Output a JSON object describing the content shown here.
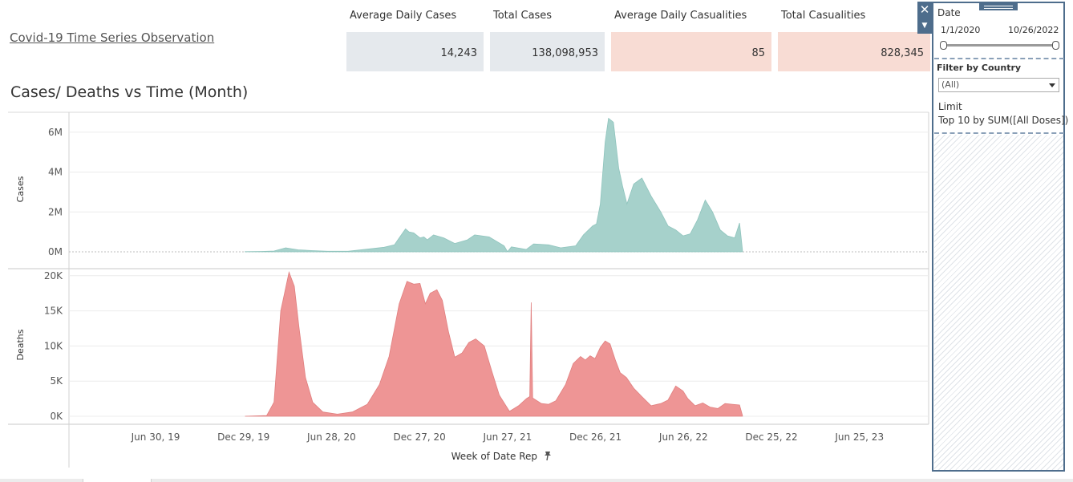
{
  "header": {
    "title": "Covid-19 Time Series Observation"
  },
  "kpis": [
    {
      "label": "Average Daily Cases",
      "value": "14,243"
    },
    {
      "label": "Total Cases",
      "value": "138,098,953"
    },
    {
      "label": "Average Daily Casualities",
      "value": "85"
    },
    {
      "label": "Total Casualities",
      "value": "828,345"
    }
  ],
  "colors": {
    "cases": "#a6d1cb",
    "cases_line": "#8fc4bd",
    "deaths": "#ee9595",
    "deaths_line": "#e07f7f",
    "kpi_blue": "#e5e9ed",
    "kpi_pink": "#f8dcd4",
    "panel_border": "#4e6d8c"
  },
  "filters": {
    "date_label": "Date",
    "date_start": "1/1/2020",
    "date_end": "10/26/2022",
    "country_label": "Filter by Country",
    "country_value": "(All)",
    "limit_label": "Limit",
    "limit_value": "Top 10 by SUM([All Doses])"
  },
  "icons": {
    "close": "close-icon",
    "menu": "menu-caret-icon",
    "pin": "pin-icon",
    "dropdown": "chevron-down-icon"
  },
  "chart_data": {
    "type": "area",
    "title": "Cases/ Deaths vs Time (Month)",
    "xlabel": "Week of Date Rep",
    "x_ticks": [
      "Jun 30, 19",
      "Dec 29, 19",
      "Jun 28, 20",
      "Dec 27, 20",
      "Jun 27, 21",
      "Dec 26, 21",
      "Jun 26, 22",
      "Dec 25, 22",
      "Jun 25, 23"
    ],
    "grid": true,
    "panels": [
      {
        "name": "Cases",
        "ylabel": "Cases",
        "ylim": [
          0,
          7000000
        ],
        "y_ticks": [
          0,
          2000000,
          4000000,
          6000000
        ],
        "y_tick_labels": [
          "0M",
          "2M",
          "4M",
          "6M"
        ],
        "series": [
          {
            "x": [
              "2020-01-01",
              "2020-02-05",
              "2020-03-01",
              "2020-03-25",
              "2020-04-20",
              "2020-05-20",
              "2020-06-20",
              "2020-08-01",
              "2020-09-15",
              "2020-10-15",
              "2020-11-05",
              "2020-11-15",
              "2020-11-28",
              "2020-12-05",
              "2020-12-15",
              "2020-12-28",
              "2021-01-05",
              "2021-01-12",
              "2021-01-25",
              "2021-02-15",
              "2021-03-10",
              "2021-04-05",
              "2021-04-20",
              "2021-05-20",
              "2021-06-20",
              "2021-06-27",
              "2021-07-05",
              "2021-08-05",
              "2021-08-20",
              "2021-09-20",
              "2021-10-15",
              "2021-11-15",
              "2021-12-01",
              "2021-12-20",
              "2021-12-28",
              "2022-01-05",
              "2022-01-15",
              "2022-01-22",
              "2022-02-01",
              "2022-02-12",
              "2022-02-20",
              "2022-03-01",
              "2022-03-15",
              "2022-04-01",
              "2022-04-20",
              "2022-05-10",
              "2022-05-25",
              "2022-06-10",
              "2022-06-25",
              "2022-07-10",
              "2022-07-25",
              "2022-08-10",
              "2022-08-25",
              "2022-09-10",
              "2022-09-25",
              "2022-10-10",
              "2022-10-20",
              "2022-10-26"
            ],
            "values": [
              10000,
              20000,
              40000,
              200000,
              100000,
              60000,
              30000,
              30000,
              150000,
              230000,
              350000,
              700000,
              1150000,
              1000000,
              950000,
              700000,
              750000,
              600000,
              850000,
              700000,
              420000,
              600000,
              850000,
              750000,
              300000,
              10000,
              250000,
              120000,
              400000,
              350000,
              200000,
              300000,
              850000,
              1300000,
              1400000,
              2400000,
              5500000,
              6700000,
              6500000,
              4200000,
              3300000,
              2400000,
              3400000,
              3700000,
              2800000,
              2000000,
              1300000,
              1100000,
              800000,
              900000,
              1600000,
              2600000,
              2000000,
              1100000,
              800000,
              700000,
              1450000,
              100000
            ]
          }
        ]
      },
      {
        "name": "Deaths",
        "ylabel": "Deaths",
        "ylim": [
          0,
          21000
        ],
        "y_ticks": [
          0,
          5000,
          10000,
          15000,
          20000
        ],
        "y_tick_labels": [
          "0K",
          "5K",
          "10K",
          "15K",
          "20K"
        ],
        "series": [
          {
            "x": [
              "2020-01-01",
              "2020-02-15",
              "2020-03-01",
              "2020-03-15",
              "2020-04-01",
              "2020-04-12",
              "2020-04-22",
              "2020-05-05",
              "2020-05-20",
              "2020-06-10",
              "2020-07-10",
              "2020-08-10",
              "2020-09-10",
              "2020-10-05",
              "2020-10-25",
              "2020-11-15",
              "2020-12-01",
              "2020-12-15",
              "2020-12-28",
              "2021-01-08",
              "2021-01-18",
              "2021-02-01",
              "2021-02-12",
              "2021-02-25",
              "2021-03-10",
              "2021-03-25",
              "2021-04-08",
              "2021-04-22",
              "2021-05-10",
              "2021-05-25",
              "2021-06-10",
              "2021-07-01",
              "2021-07-20",
              "2021-08-05",
              "2021-08-12",
              "2021-08-15",
              "2021-08-18",
              "2021-09-05",
              "2021-09-20",
              "2021-10-05",
              "2021-10-25",
              "2021-11-10",
              "2021-11-25",
              "2021-12-05",
              "2021-12-15",
              "2021-12-25",
              "2022-01-05",
              "2022-01-15",
              "2022-01-25",
              "2022-02-05",
              "2022-02-15",
              "2022-02-28",
              "2022-03-15",
              "2022-04-01",
              "2022-04-20",
              "2022-05-10",
              "2022-05-25",
              "2022-06-10",
              "2022-06-25",
              "2022-07-05",
              "2022-07-20",
              "2022-08-05",
              "2022-08-20",
              "2022-09-05",
              "2022-09-20",
              "2022-10-05",
              "2022-10-20",
              "2022-10-26"
            ],
            "values": [
              0,
              100,
              2000,
              15000,
              20500,
              18500,
              12500,
              5500,
              2000,
              600,
              300,
              600,
              1700,
              4500,
              8500,
              16000,
              19200,
              18800,
              18900,
              16000,
              17500,
              18000,
              16500,
              12000,
              8400,
              9000,
              10500,
              11000,
              10000,
              6500,
              3000,
              700,
              1500,
              2500,
              2800,
              16200,
              2600,
              1800,
              1700,
              2200,
              4500,
              7500,
              8500,
              8000,
              8600,
              8200,
              9800,
              10700,
              10300,
              8000,
              6200,
              5500,
              4000,
              2800,
              1500,
              1800,
              2300,
              4300,
              3600,
              2500,
              1500,
              1900,
              1300,
              1100,
              1800,
              1700,
              1600,
              100
            ]
          }
        ]
      }
    ]
  }
}
